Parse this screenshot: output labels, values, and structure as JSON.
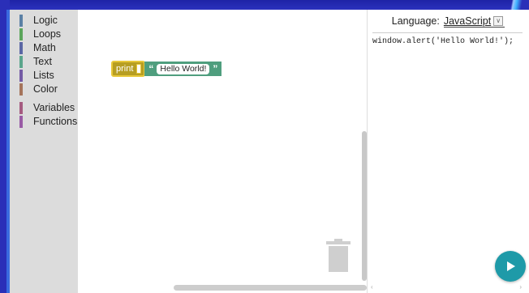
{
  "toolbox": {
    "items": [
      {
        "label": "Logic",
        "color": "#5b80a5"
      },
      {
        "label": "Loops",
        "color": "#5ba55b"
      },
      {
        "label": "Math",
        "color": "#5b67a5"
      },
      {
        "label": "Text",
        "color": "#5ba58c"
      },
      {
        "label": "Lists",
        "color": "#745ba5"
      },
      {
        "label": "Color",
        "color": "#a5745b"
      },
      {
        "label": "Variables",
        "color": "#a55b80"
      },
      {
        "label": "Functions",
        "color": "#995ba5"
      }
    ]
  },
  "workspace": {
    "print_block": {
      "label": "print",
      "color": "#b79e22"
    },
    "text_block": {
      "open_quote": "“",
      "value": "Hello World!",
      "close_quote": "”",
      "color": "#4f9e7e"
    }
  },
  "code_pane": {
    "language_label": "Language:",
    "language_value": "JavaScript",
    "code": "window.alert('Hello World!');"
  },
  "icons": {
    "trash": "trash-icon",
    "run": "play-icon",
    "dropdown": "chevron-down-icon"
  },
  "colors": {
    "frame": "#2a2fb8",
    "run_button": "#1e9aa8"
  }
}
